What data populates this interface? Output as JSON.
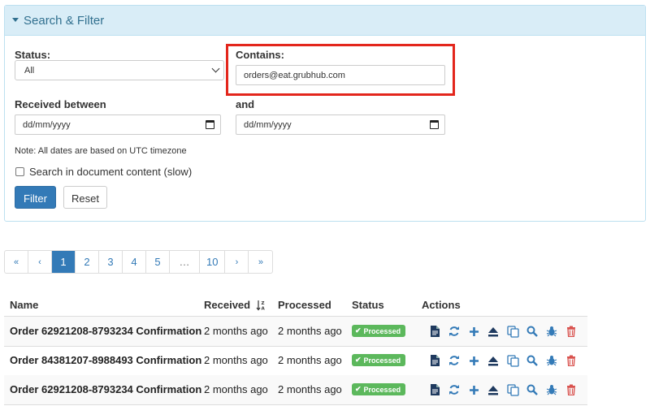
{
  "panel": {
    "title": "Search & Filter"
  },
  "filters": {
    "status_label": "Status:",
    "status_value": "All",
    "contains_label": "Contains:",
    "contains_value": "orders@eat.grubhub.com",
    "received_label": "Received between",
    "and_label": "and",
    "date_from_value": "dd/mm/yyyy",
    "date_to_value": "dd/mm/yyyy",
    "note": "Note: All dates are based on UTC timezone",
    "search_content_label": "Search in document content (slow)",
    "filter_button": "Filter",
    "reset_button": "Reset"
  },
  "pagination": {
    "first": "«",
    "prev": "‹",
    "pages": [
      "1",
      "2",
      "3",
      "4",
      "5"
    ],
    "ellipsis": "…",
    "last_page": "10",
    "next": "›",
    "last": "»",
    "current": "1"
  },
  "table": {
    "headers": {
      "name": "Name",
      "received": "Received",
      "processed": "Processed",
      "status": "Status",
      "actions": "Actions"
    },
    "sort_icon": "sort-alpha-desc-icon",
    "rows": [
      {
        "name": "Order 62921208-8793234 Confirmation",
        "received": "2 months ago",
        "processed": "2 months ago",
        "status": "Processed"
      },
      {
        "name": "Order 84381207-8988493 Confirmation",
        "received": "2 months ago",
        "processed": "2 months ago",
        "status": "Processed"
      },
      {
        "name": "Order 62921208-8793234 Confirmation",
        "received": "2 months ago",
        "processed": "2 months ago",
        "status": "Processed"
      }
    ]
  },
  "colors": {
    "primary": "#337ab7",
    "success": "#5cb85c",
    "danger": "#d9534f",
    "panel_header": "#d9edf7",
    "highlight": "#e3261c"
  }
}
